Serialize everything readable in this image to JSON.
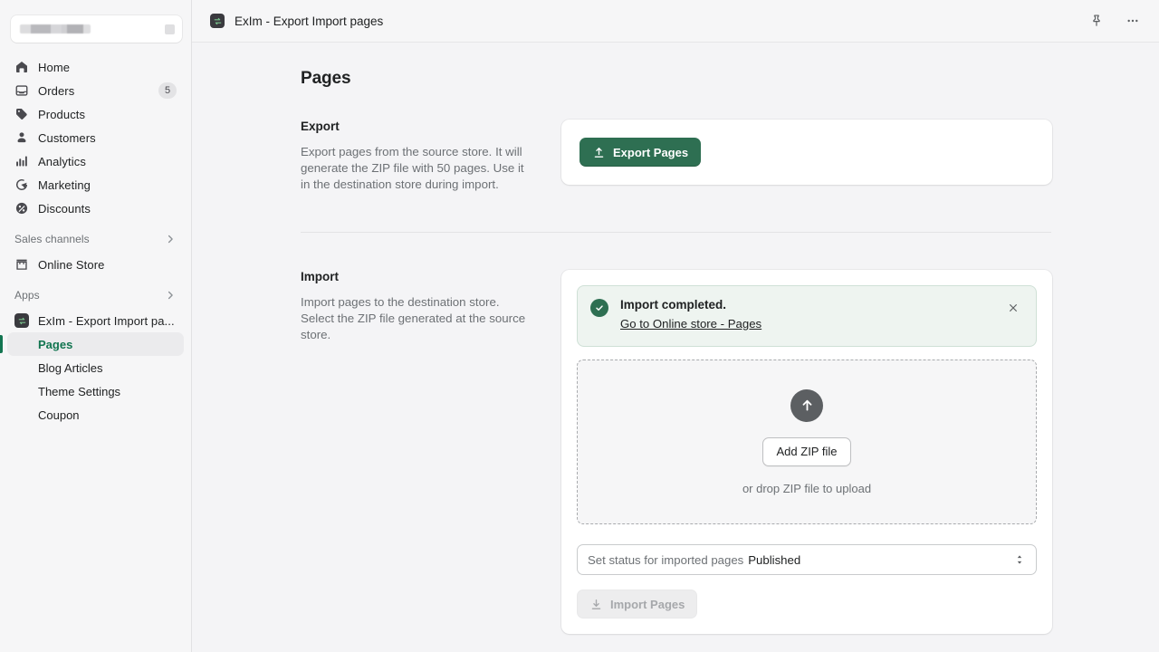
{
  "sidebar": {
    "store_switcher": {
      "name_redacted": true,
      "switch_icon": "switch-store-icon"
    },
    "items": [
      {
        "label": "Home",
        "icon": "home-icon",
        "badge": null
      },
      {
        "label": "Orders",
        "icon": "orders-inbox-icon",
        "badge": "5"
      },
      {
        "label": "Products",
        "icon": "products-tag-icon",
        "badge": null
      },
      {
        "label": "Customers",
        "icon": "customers-person-icon",
        "badge": null
      },
      {
        "label": "Analytics",
        "icon": "analytics-bar-chart-icon",
        "badge": null
      },
      {
        "label": "Marketing",
        "icon": "marketing-target-icon",
        "badge": null
      },
      {
        "label": "Discounts",
        "icon": "discounts-percent-icon",
        "badge": null
      }
    ],
    "sales_channels": {
      "label": "Sales channels",
      "chevron": "chevron-right-icon"
    },
    "online_store": {
      "label": "Online Store",
      "icon": "online-store-icon"
    },
    "apps": {
      "label": "Apps",
      "chevron": "chevron-right-icon"
    },
    "app": {
      "label": "ExIm - Export Import pa...",
      "icon": "exim-app-icon",
      "children": [
        {
          "label": "Pages",
          "active": true
        },
        {
          "label": "Blog Articles",
          "active": false
        },
        {
          "label": "Theme Settings",
          "active": false
        },
        {
          "label": "Coupon",
          "active": false
        }
      ]
    }
  },
  "topbar": {
    "app_icon": "exim-app-icon",
    "title": "ExIm - Export Import pages",
    "pin_icon": "pin-icon",
    "more_icon": "more-horizontal-icon"
  },
  "page": {
    "title": "Pages",
    "export": {
      "heading": "Export",
      "description": "Export pages from the source store. It will generate the ZIP file with 50 pages. Use it in the destination store during import.",
      "button_label": "Export Pages",
      "button_icon": "upload-arrow-icon"
    },
    "import": {
      "heading": "Import",
      "description": "Import pages to the destination store. Select the ZIP file generated at the source store.",
      "banner": {
        "status_icon": "success-check-icon",
        "title": "Import completed.",
        "link_label": "Go to Online store - Pages",
        "close_icon": "close-icon"
      },
      "dropzone": {
        "upload_icon": "upload-circle-arrow-icon",
        "button_label": "Add ZIP file",
        "hint": "or drop ZIP file to upload"
      },
      "status_select": {
        "label": "Set status for imported pages",
        "value": "Published",
        "arrows_icon": "select-updown-icon"
      },
      "submit": {
        "label": "Import Pages",
        "icon": "download-arrow-icon",
        "disabled": true
      }
    }
  },
  "colors": {
    "brand_green": "#2e6f52",
    "active_green": "#137551",
    "banner_bg": "#eef4f0",
    "banner_border": "#cfe0d6",
    "page_bg": "#f4f4f6",
    "sidebar_bg": "#f6f6f7",
    "disabled_bg": "#ededee",
    "disabled_text": "#a6a8ab"
  }
}
